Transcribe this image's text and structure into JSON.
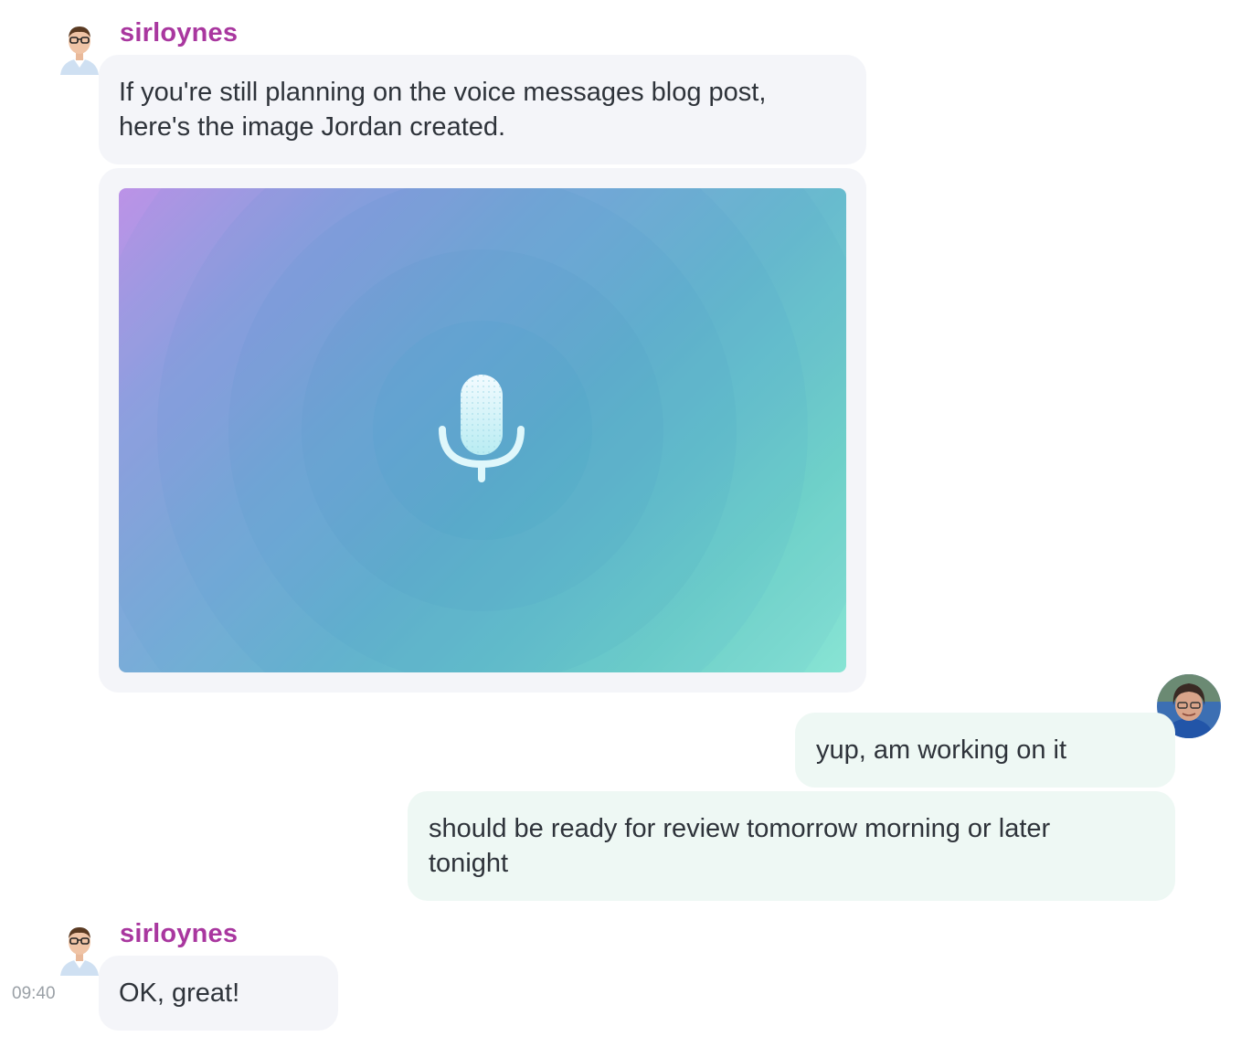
{
  "messages": [
    {
      "sender": "sirloynes",
      "text": "If you're still planning on the voice messages blog post, here's the image Jordan created.",
      "attachment": {
        "icon": "microphone-icon"
      }
    },
    {
      "outgoing_1": "yup, am working on it",
      "outgoing_2": "should be ready for review tomorrow morning or later tonight"
    },
    {
      "sender": "sirloynes",
      "text": "OK, great!",
      "time": "09:40"
    }
  ],
  "colors": {
    "sender_name": "#a9379f",
    "incoming_bubble": "#f4f5f9",
    "outgoing_bubble": "#eef8f4"
  }
}
